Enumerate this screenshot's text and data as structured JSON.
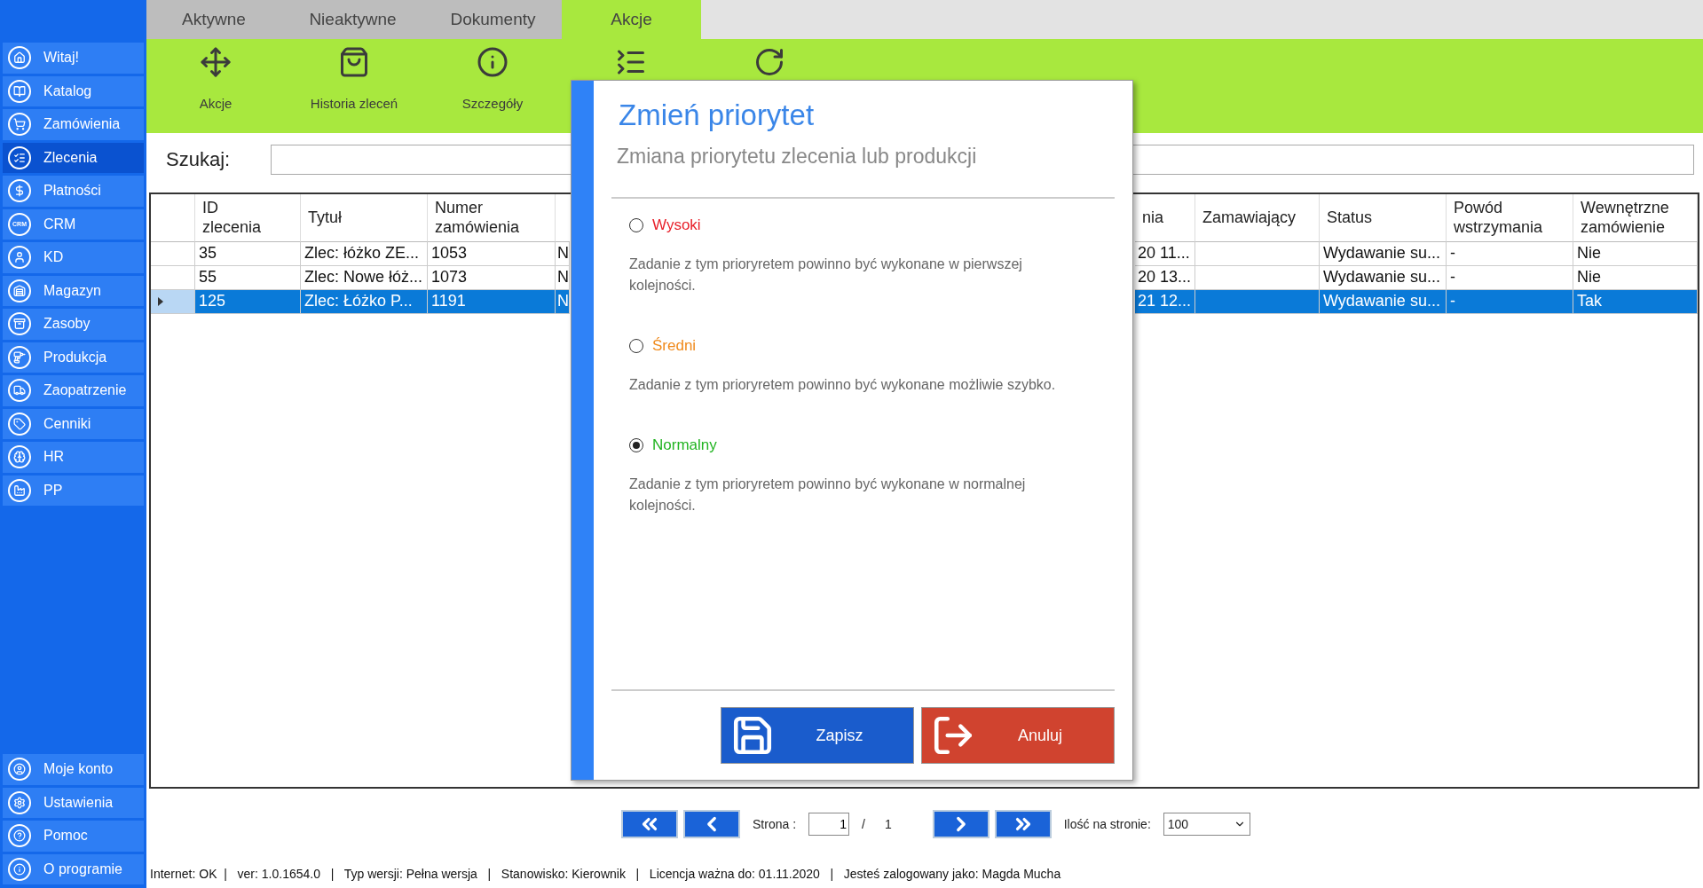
{
  "sidebar": {
    "items": [
      {
        "label": "Witaj!",
        "selected": false
      },
      {
        "label": "Katalog",
        "selected": false
      },
      {
        "label": "Zamówienia",
        "selected": false
      },
      {
        "label": "Zlecenia",
        "selected": true
      },
      {
        "label": "Płatności",
        "selected": false
      },
      {
        "label": "CRM",
        "selected": false,
        "icon_text": "CRM"
      },
      {
        "label": "KD",
        "selected": false
      },
      {
        "label": "Magazyn",
        "selected": false
      },
      {
        "label": "Zasoby",
        "selected": false
      },
      {
        "label": "Produkcja",
        "selected": false
      },
      {
        "label": "Zaopatrzenie",
        "selected": false
      },
      {
        "label": "Cenniki",
        "selected": false
      },
      {
        "label": "HR",
        "selected": false
      },
      {
        "label": "PP",
        "selected": false
      }
    ],
    "bottom_items": [
      {
        "label": "Moje konto",
        "selected": false
      },
      {
        "label": "Ustawienia",
        "selected": false
      },
      {
        "label": "Pomoc",
        "selected": false
      },
      {
        "label": "O programie",
        "selected": false
      }
    ]
  },
  "tabs": [
    {
      "label": "Aktywne",
      "selected": false
    },
    {
      "label": "Nieaktywne",
      "selected": false
    },
    {
      "label": "Dokumenty",
      "selected": false
    },
    {
      "label": "Akcje",
      "selected": true
    }
  ],
  "toolbar": {
    "labels": [
      "Akcje",
      "Historia zleceń",
      "Szczegóły"
    ]
  },
  "search": {
    "label": "Szukaj:"
  },
  "table": {
    "columns": [
      "ID\nzlecenia",
      "Tytuł",
      "Numer\nzamówienia",
      "",
      "nia",
      "Zamawiający",
      "Status",
      "Powód\nwstrzymania",
      "Wewnętrzne\nzamówienie"
    ],
    "rows": [
      {
        "selected": false,
        "cells": [
          "35",
          "Zlec: łóżko ZE...",
          "1053",
          "N",
          "20 11...",
          "",
          "Wydawanie su...",
          "-",
          "Nie"
        ]
      },
      {
        "selected": false,
        "cells": [
          "55",
          "Zlec: Nowe łóż...",
          "1073",
          "N",
          "20 13...",
          "",
          "Wydawanie su...",
          "-",
          "Nie"
        ]
      },
      {
        "selected": true,
        "cells": [
          "125",
          "Zlec: Łóżko P...",
          "1191",
          "N",
          "21 12...",
          "",
          "Wydawanie su...",
          "-",
          "Tak"
        ]
      }
    ]
  },
  "dialog": {
    "title": "Zmień priorytet",
    "subtitle": "Zmiana priorytetu zlecenia lub produkcji",
    "options": [
      {
        "label": "Wysoki",
        "color": "#e8202a",
        "selected": false,
        "description": "Zadanie z tym prioryretem powinno być wykonane w pierwszej kolejności."
      },
      {
        "label": "Średni",
        "color": "#f08a1c",
        "selected": false,
        "description": "Zadanie z tym prioryretem powinno być wykonane możliwie szybko."
      },
      {
        "label": "Normalny",
        "color": "#22b422",
        "selected": true,
        "description": "Zadanie z tym prioryretem powinno być wykonane w normalnej kolejności."
      }
    ],
    "buttons": [
      {
        "kind": "save",
        "label": "Zapisz"
      },
      {
        "kind": "cancel",
        "label": "Anuluj"
      }
    ]
  },
  "pagination": {
    "page_label": "Strona :",
    "page": "1",
    "separator": "/",
    "total": "1",
    "per_page_label": "Ilość na stronie:",
    "per_page": "100"
  },
  "status_bar": "Internet: OK  |   ver: 1.0.1654.0   |   Typ wersji: Pełna wersja   |   Stanowisko: Kierownik   |   Licencja ważna do: 01.11.2020   |   Jesteś zalogowany jako: Magda Mucha"
}
